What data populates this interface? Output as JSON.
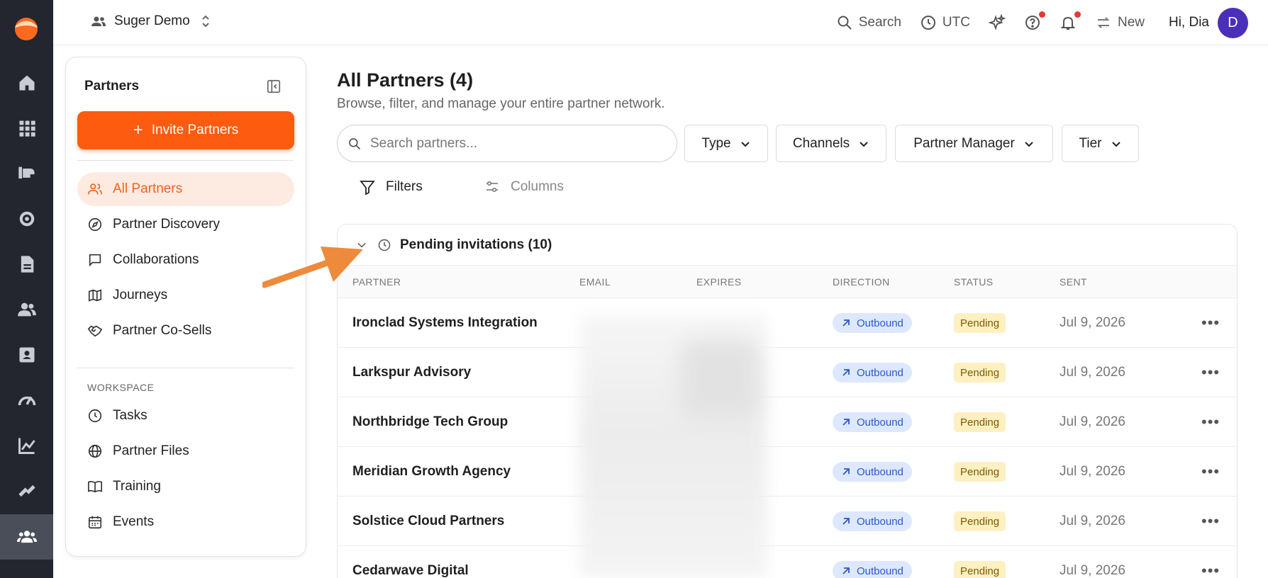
{
  "colors": {
    "accent": "#fd5b0f",
    "rail": "#23262f",
    "annotation_arrow": "#ee8a3c"
  },
  "topbar": {
    "workspace_name": "Suger Demo",
    "search_label": "Search",
    "timezone_label": "UTC",
    "new_label": "New",
    "greeting": "Hi, Dia",
    "avatar_initial": "D"
  },
  "panel": {
    "title": "Partners",
    "invite_label": "Invite Partners",
    "nav": [
      {
        "label": "All Partners",
        "icon": "users-icon",
        "active": true
      },
      {
        "label": "Partner Discovery",
        "icon": "compass-icon"
      },
      {
        "label": "Collaborations",
        "icon": "chat-icon"
      },
      {
        "label": "Journeys",
        "icon": "map-icon"
      },
      {
        "label": "Partner Co-Sells",
        "icon": "handshake-icon"
      }
    ],
    "workspace_label": "WORKSPACE",
    "workspace_nav": [
      {
        "label": "Tasks",
        "icon": "clock-icon"
      },
      {
        "label": "Partner Files",
        "icon": "globe-icon"
      },
      {
        "label": "Training",
        "icon": "book-icon"
      },
      {
        "label": "Events",
        "icon": "calendar-icon"
      }
    ]
  },
  "main": {
    "title": "All Partners (4)",
    "subtitle": "Browse, filter, and manage your entire partner network.",
    "search_placeholder": "Search partners...",
    "filters": [
      "Type",
      "Channels",
      "Partner Manager",
      "Tier"
    ],
    "filters_label": "Filters",
    "columns_label": "Columns"
  },
  "pending": {
    "title": "Pending invitations (10)",
    "columns": [
      "PARTNER",
      "EMAIL",
      "EXPIRES",
      "DIRECTION",
      "STATUS",
      "SENT"
    ],
    "rows": [
      {
        "partner": "Ironclad Systems Integration",
        "direction": "Outbound",
        "status": "Pending",
        "sent": "Jul 9, 2026"
      },
      {
        "partner": "Larkspur Advisory",
        "direction": "Outbound",
        "status": "Pending",
        "sent": "Jul 9, 2026"
      },
      {
        "partner": "Northbridge Tech Group",
        "direction": "Outbound",
        "status": "Pending",
        "sent": "Jul 9, 2026"
      },
      {
        "partner": "Meridian Growth Agency",
        "direction": "Outbound",
        "status": "Pending",
        "sent": "Jul 9, 2026"
      },
      {
        "partner": "Solstice Cloud Partners",
        "direction": "Outbound",
        "status": "Pending",
        "sent": "Jul 9, 2026"
      },
      {
        "partner": "Cedarwave Digital",
        "direction": "Outbound",
        "status": "Pending",
        "sent": "Jul 9, 2026"
      }
    ]
  }
}
